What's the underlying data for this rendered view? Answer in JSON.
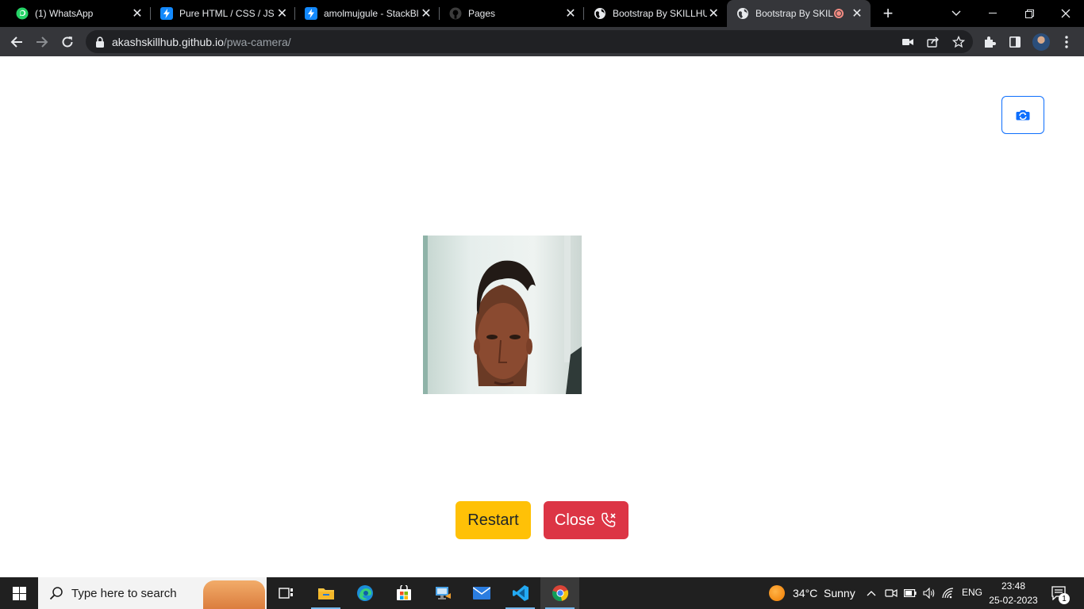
{
  "browser": {
    "tabs": [
      {
        "title": "(1) WhatsApp",
        "favicon": "whatsapp-icon",
        "active": false
      },
      {
        "title": "Pure HTML / CSS / JS (",
        "favicon": "stackblitz-icon",
        "active": false
      },
      {
        "title": "amolmujgule - StackBl",
        "favicon": "stackblitz-icon",
        "active": false
      },
      {
        "title": "Pages",
        "favicon": "github-icon",
        "active": false
      },
      {
        "title": "Bootstrap By SKILLHU",
        "favicon": "globe-icon",
        "active": false
      },
      {
        "title": "Bootstrap By SKIL",
        "favicon": "globe-icon",
        "active": true,
        "recording": true
      }
    ],
    "address": {
      "host": "akashskillhub.github.io",
      "path": "/pwa-camera/"
    }
  },
  "page": {
    "camera_switch_icon": "camera-flip-icon",
    "buttons": {
      "restart_label": "Restart",
      "close_label": "Close",
      "close_icon": "telephone-x-icon"
    },
    "colors": {
      "restart": "#ffc107",
      "close": "#dc3545",
      "outline_primary": "#0d6efd"
    }
  },
  "taskbar": {
    "search_placeholder": "Type here to search",
    "weather": {
      "temp": "34°C",
      "condition": "Sunny"
    },
    "language": "ENG",
    "time": "23:48",
    "date": "25-02-2023",
    "notification_count": "1",
    "pinned_apps": [
      "task-view-icon",
      "file-explorer-icon",
      "edge-icon",
      "store-icon",
      "network-app-icon",
      "mail-icon",
      "vscode-icon",
      "chrome-icon"
    ]
  }
}
